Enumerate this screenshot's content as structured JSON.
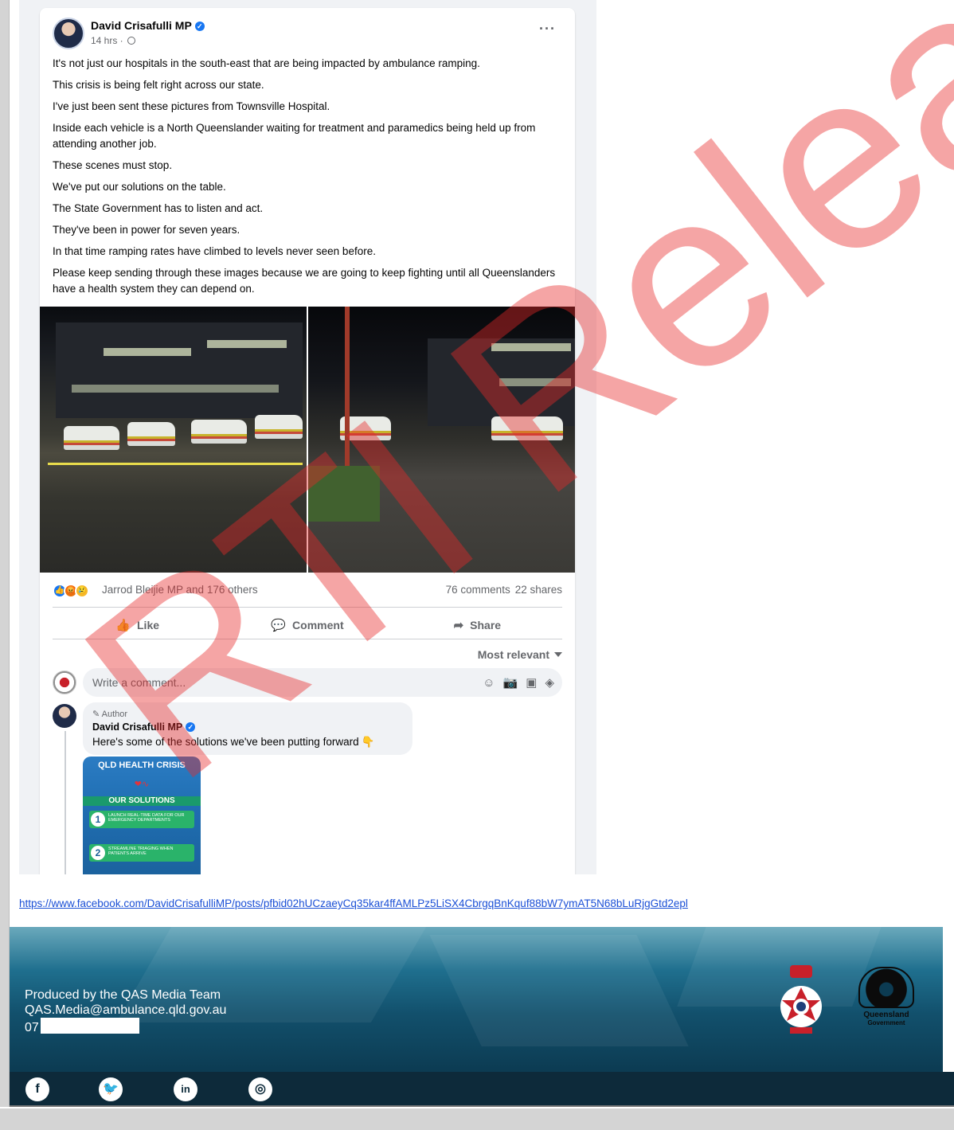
{
  "post": {
    "author": "David Crisafulli MP",
    "timestamp": "14 hrs ·",
    "more_label": "···",
    "paragraphs": [
      "It's not just our hospitals in the south-east that are being impacted by ambulance ramping.",
      "This crisis is being felt right across our state.",
      "I've just been sent these pictures from Townsville Hospital.",
      "Inside each vehicle is a North Queenslander waiting for treatment and paramedics being held up from attending another job.",
      "These scenes must stop.",
      "We've put our solutions on the table.",
      "The State Government has to listen and act.",
      "They've been in power for seven years.",
      "In that time ramping rates have climbed to levels never seen before.",
      "Please keep sending through these images because we are going to keep fighting until all Queenslanders have a health system they can depend on."
    ],
    "reactions_text": "Jarrod Bleijie MP and 176 others",
    "comments_count": "76 comments",
    "shares_count": "22 shares",
    "actions": {
      "like": "Like",
      "comment": "Comment",
      "share": "Share"
    },
    "sort_label": "Most relevant",
    "composer_placeholder": "Write a comment...",
    "comment": {
      "badge": "Author",
      "author": "David Crisafulli MP",
      "text": "Here's some of the solutions we've been putting forward"
    },
    "solutions_card": {
      "title": "QLD HEALTH CRISIS",
      "heading": "OUR SOLUTIONS",
      "items": [
        {
          "num": "1",
          "text": "LAUNCH REAL-TIME DATA FOR OUR EMERGENCY DEPARTMENTS"
        },
        {
          "num": "2",
          "text": "STREAMLINE TRIAGING WHEN PATIENTS ARRIVE"
        }
      ]
    }
  },
  "url": "https://www.facebook.com/DavidCrisafulliMP/posts/pfbid02hUCzaeyCq35kar4ffAMLPz5LiSX4CbrgqBnKquf88bW7ymAT5N68bLuRjgGtd2epl",
  "footer": {
    "line1": "Produced by the QAS Media Team",
    "line2": "QAS.Media@ambulance.qld.gov.au",
    "line3_prefix": "07",
    "qld_logo_text": "Queensland",
    "qld_logo_sub": "Government"
  },
  "social_icons": [
    "facebook-icon",
    "twitter-icon",
    "linkedin-icon",
    "instagram-icon"
  ],
  "watermark": "RTI Release",
  "colors": {
    "facebook_blue": "#1877f2",
    "link_blue": "#1a4fd6",
    "banner_dark": "#0c3b52",
    "watermark_red": "#e62828"
  }
}
